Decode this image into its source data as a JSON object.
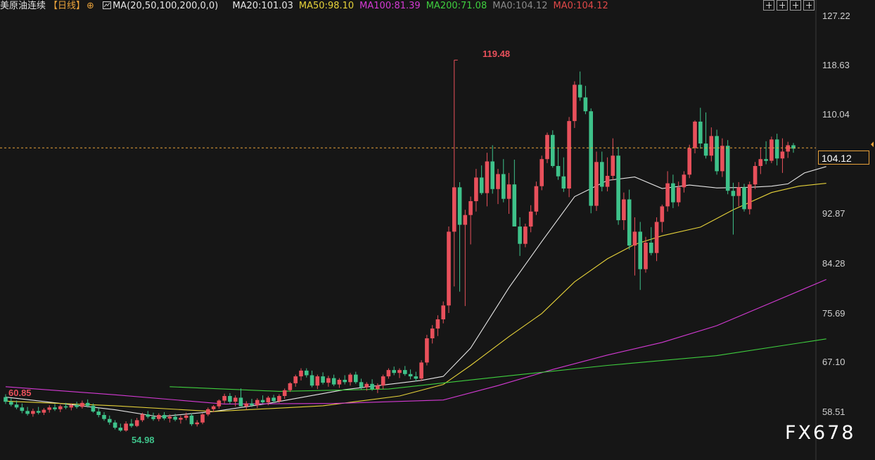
{
  "legend": {
    "title": "美原油连续",
    "period": "【日线】",
    "indicator": "MA(20,50,100,200,0,0)",
    "items": [
      {
        "label": "MA20:101.03",
        "color": "#e6e6e6"
      },
      {
        "label": "MA50:98.10",
        "color": "#e6d23a"
      },
      {
        "label": "MA100:81.39",
        "color": "#d43ad4"
      },
      {
        "label": "MA200:71.08",
        "color": "#3fcf3f"
      },
      {
        "label": "MA0:104.12",
        "color": "#8a8a8a"
      },
      {
        "label": "MA0:104.12",
        "color": "#e04848"
      }
    ]
  },
  "toolbar": {
    "icons": [
      "zoom-in-icon",
      "zoom-out-icon",
      "scroll-left-icon",
      "scroll-right-icon"
    ]
  },
  "last_price": "104.12",
  "watermark": "FX678",
  "colors": {
    "up": "#e8505b",
    "down": "#3ec28a",
    "bg": "#161616",
    "grid": "#2a2a2a",
    "last": "#e8a13a"
  },
  "chart_data": {
    "type": "candlestick",
    "title": "美原油连续",
    "y_ticks": [
      "127.22",
      "118.63",
      "110.04",
      "104.12",
      "92.87",
      "84.28",
      "75.69",
      "67.10",
      "58.51"
    ],
    "ylim": [
      54.0,
      127.22
    ],
    "annotations": [
      {
        "label": "119.48",
        "kind": "high",
        "color": "#e8505b"
      },
      {
        "label": "60.85",
        "kind": "left",
        "color": "#e8505b"
      },
      {
        "label": "54.98",
        "kind": "low",
        "color": "#3ec28a"
      }
    ],
    "candles": [
      [
        61.0,
        61.5,
        59.8,
        60.2
      ],
      [
        60.2,
        60.8,
        59.4,
        59.7
      ],
      [
        59.7,
        60.4,
        58.9,
        59.2
      ],
      [
        59.2,
        59.9,
        58.2,
        58.6
      ],
      [
        58.6,
        59.3,
        57.8,
        58.1
      ],
      [
        58.1,
        59.0,
        57.6,
        58.6
      ],
      [
        58.6,
        59.3,
        58.0,
        58.3
      ],
      [
        58.3,
        59.1,
        57.9,
        58.8
      ],
      [
        58.8,
        59.6,
        58.3,
        59.2
      ],
      [
        59.2,
        59.8,
        58.6,
        58.9
      ],
      [
        58.9,
        59.7,
        58.4,
        59.4
      ],
      [
        59.4,
        60.0,
        58.9,
        59.2
      ],
      [
        59.2,
        59.9,
        58.7,
        59.6
      ],
      [
        59.6,
        60.2,
        59.0,
        59.3
      ],
      [
        59.3,
        60.4,
        59.0,
        60.0
      ],
      [
        60.0,
        60.6,
        59.2,
        59.5
      ],
      [
        59.5,
        59.9,
        58.3,
        58.5
      ],
      [
        58.5,
        59.1,
        57.5,
        57.9
      ],
      [
        57.9,
        58.4,
        56.9,
        57.2
      ],
      [
        57.2,
        57.8,
        56.2,
        56.6
      ],
      [
        56.6,
        57.0,
        55.4,
        55.7
      ],
      [
        55.7,
        56.4,
        54.98,
        55.2
      ],
      [
        55.2,
        56.8,
        55.0,
        56.4
      ],
      [
        56.4,
        57.2,
        55.7,
        56.0
      ],
      [
        56.0,
        57.4,
        55.8,
        57.0
      ],
      [
        57.0,
        58.3,
        56.7,
        58.0
      ],
      [
        58.0,
        58.6,
        57.3,
        57.6
      ],
      [
        57.6,
        58.3,
        56.9,
        57.2
      ],
      [
        57.2,
        58.2,
        56.8,
        57.9
      ],
      [
        57.9,
        58.4,
        57.0,
        57.3
      ],
      [
        57.3,
        58.0,
        56.6,
        57.6
      ],
      [
        57.6,
        58.1,
        56.8,
        57.1
      ],
      [
        57.1,
        57.8,
        56.4,
        57.4
      ],
      [
        57.4,
        58.3,
        57.0,
        57.8
      ],
      [
        57.8,
        58.2,
        56.0,
        56.3
      ],
      [
        56.3,
        57.0,
        55.9,
        56.6
      ],
      [
        56.6,
        58.2,
        56.3,
        58.0
      ],
      [
        58.0,
        59.2,
        57.7,
        58.9
      ],
      [
        58.9,
        59.6,
        58.4,
        59.4
      ],
      [
        59.4,
        60.6,
        59.0,
        60.4
      ],
      [
        60.4,
        61.6,
        59.9,
        61.2
      ],
      [
        61.2,
        61.7,
        59.8,
        60.2
      ],
      [
        60.2,
        61.3,
        59.4,
        60.9
      ],
      [
        60.9,
        62.5,
        60.2,
        59.4
      ],
      [
        59.4,
        60.3,
        58.8,
        59.9
      ],
      [
        59.9,
        60.7,
        59.3,
        59.6
      ],
      [
        59.6,
        60.8,
        59.1,
        60.5
      ],
      [
        60.5,
        61.3,
        59.9,
        60.1
      ],
      [
        60.1,
        61.2,
        59.6,
        60.9
      ],
      [
        60.9,
        61.4,
        60.0,
        60.3
      ],
      [
        60.3,
        61.5,
        60.0,
        61.2
      ],
      [
        61.2,
        62.5,
        60.7,
        62.2
      ],
      [
        62.2,
        63.6,
        61.9,
        63.4
      ],
      [
        63.4,
        64.9,
        62.8,
        64.6
      ],
      [
        64.6,
        66.0,
        63.9,
        65.6
      ],
      [
        65.6,
        66.0,
        64.4,
        64.8
      ],
      [
        64.8,
        65.6,
        62.7,
        63.0
      ],
      [
        63.0,
        64.9,
        62.4,
        64.6
      ],
      [
        64.6,
        65.3,
        63.2,
        63.5
      ],
      [
        63.5,
        64.7,
        62.8,
        64.3
      ],
      [
        64.3,
        64.9,
        62.9,
        63.2
      ],
      [
        63.2,
        64.3,
        62.6,
        64.0
      ],
      [
        64.0,
        64.8,
        63.2,
        63.6
      ],
      [
        63.6,
        65.2,
        63.0,
        64.9
      ],
      [
        64.9,
        65.4,
        63.3,
        63.6
      ],
      [
        63.6,
        64.2,
        62.3,
        62.7
      ],
      [
        62.7,
        63.6,
        62.1,
        63.3
      ],
      [
        63.3,
        64.1,
        62.1,
        62.4
      ],
      [
        62.4,
        63.4,
        61.7,
        63.0
      ],
      [
        63.0,
        64.9,
        62.4,
        64.6
      ],
      [
        64.6,
        66.0,
        64.2,
        65.7
      ],
      [
        65.7,
        66.3,
        64.8,
        65.2
      ],
      [
        65.2,
        66.0,
        64.3,
        65.7
      ],
      [
        65.7,
        66.4,
        64.7,
        65.0
      ],
      [
        65.0,
        65.8,
        64.1,
        64.6
      ],
      [
        64.6,
        65.4,
        63.7,
        64.2
      ],
      [
        64.2,
        67.4,
        63.8,
        67.0
      ],
      [
        67.0,
        71.8,
        66.5,
        71.2
      ],
      [
        71.2,
        73.5,
        70.3,
        72.9
      ],
      [
        72.9,
        75.2,
        71.6,
        74.5
      ],
      [
        74.5,
        77.6,
        73.8,
        76.9
      ],
      [
        76.9,
        90.6,
        75.6,
        89.7
      ],
      [
        89.7,
        119.48,
        80.2,
        97.4
      ],
      [
        97.4,
        98.3,
        79.3,
        90.9
      ],
      [
        90.9,
        93.5,
        76.8,
        92.6
      ],
      [
        92.6,
        95.8,
        87.5,
        95.0
      ],
      [
        95.0,
        100.6,
        93.2,
        99.1
      ],
      [
        99.1,
        101.2,
        96.1,
        96.4
      ],
      [
        96.4,
        103.4,
        94.1,
        101.9
      ],
      [
        101.9,
        104.7,
        96.3,
        97.1
      ],
      [
        97.1,
        100.6,
        94.5,
        99.7
      ],
      [
        99.7,
        102.3,
        94.8,
        95.4
      ],
      [
        95.4,
        99.9,
        92.8,
        97.9
      ],
      [
        97.9,
        102.2,
        92.3,
        90.6
      ],
      [
        90.6,
        92.2,
        85.5,
        87.6
      ],
      [
        87.6,
        91.1,
        87.0,
        90.6
      ],
      [
        90.6,
        94.3,
        89.6,
        93.2
      ],
      [
        93.2,
        98.4,
        92.6,
        97.6
      ],
      [
        97.6,
        102.9,
        96.9,
        102.3
      ],
      [
        102.3,
        106.9,
        101.6,
        106.5
      ],
      [
        106.5,
        107.3,
        100.8,
        101.1
      ],
      [
        101.1,
        104.2,
        98.7,
        99.3
      ],
      [
        99.3,
        102.6,
        96.6,
        97.2
      ],
      [
        97.2,
        109.6,
        95.7,
        108.9
      ],
      [
        108.9,
        115.8,
        107.7,
        115.2
      ],
      [
        115.2,
        117.5,
        112.4,
        113.0
      ],
      [
        113.0,
        115.0,
        110.1,
        110.6
      ],
      [
        110.6,
        111.1,
        92.9,
        94.2
      ],
      [
        94.2,
        103.6,
        93.3,
        101.8
      ],
      [
        101.8,
        103.6,
        96.7,
        97.5
      ],
      [
        97.5,
        102.6,
        96.7,
        99.4
      ],
      [
        99.4,
        105.9,
        98.6,
        102.9
      ],
      [
        102.9,
        104.4,
        90.9,
        91.7
      ],
      [
        91.7,
        96.5,
        90.0,
        95.3
      ],
      [
        95.3,
        97.0,
        86.6,
        87.3
      ],
      [
        87.3,
        92.2,
        82.1,
        89.7
      ],
      [
        89.7,
        91.4,
        79.6,
        83.2
      ],
      [
        83.2,
        88.8,
        82.6,
        87.8
      ],
      [
        87.8,
        90.5,
        85.6,
        86.0
      ],
      [
        86.0,
        92.2,
        84.6,
        91.4
      ],
      [
        91.4,
        94.4,
        89.6,
        94.1
      ],
      [
        94.1,
        100.2,
        93.2,
        98.1
      ],
      [
        98.1,
        99.6,
        93.8,
        94.8
      ],
      [
        94.8,
        98.4,
        94.1,
        97.4
      ],
      [
        97.4,
        100.2,
        96.5,
        99.6
      ],
      [
        99.6,
        104.8,
        99.0,
        104.2
      ],
      [
        104.2,
        109.0,
        103.3,
        108.8
      ],
      [
        108.8,
        111.2,
        104.1,
        105.0
      ],
      [
        105.0,
        110.4,
        102.4,
        102.9
      ],
      [
        102.9,
        107.8,
        101.9,
        106.3
      ],
      [
        106.3,
        107.4,
        99.6,
        100.2
      ],
      [
        100.2,
        105.9,
        99.2,
        104.6
      ],
      [
        104.6,
        105.6,
        96.2,
        96.8
      ],
      [
        96.8,
        98.2,
        89.2,
        95.9
      ],
      [
        95.9,
        98.3,
        94.1,
        97.4
      ],
      [
        97.4,
        98.0,
        93.2,
        93.6
      ],
      [
        93.6,
        98.4,
        92.7,
        97.9
      ],
      [
        97.9,
        101.8,
        97.1,
        101.1
      ],
      [
        101.1,
        104.2,
        99.7,
        102.3
      ],
      [
        102.3,
        105.4,
        101.4,
        102.0
      ],
      [
        102.0,
        106.2,
        101.6,
        105.7
      ],
      [
        105.7,
        106.7,
        101.2,
        102.4
      ],
      [
        102.4,
        105.9,
        99.9,
        103.6
      ],
      [
        103.6,
        105.3,
        102.5,
        104.7
      ],
      [
        104.7,
        105.1,
        103.4,
        104.12
      ]
    ],
    "series": [
      {
        "name": "MA20",
        "color": "#e6e6e6",
        "points": [
          [
            0,
            61.0
          ],
          [
            20,
            58.8
          ],
          [
            28,
            57.6
          ],
          [
            38,
            58.5
          ],
          [
            48,
            59.9
          ],
          [
            62,
            62.3
          ],
          [
            76,
            63.9
          ],
          [
            80,
            64.6
          ],
          [
            85,
            69.5
          ],
          [
            92,
            80.0
          ],
          [
            98,
            88.0
          ],
          [
            104,
            95.8
          ],
          [
            110,
            98.6
          ],
          [
            115,
            99.2
          ],
          [
            120,
            97.2
          ],
          [
            125,
            97.8
          ],
          [
            130,
            97.3
          ],
          [
            136,
            97.4
          ],
          [
            140,
            97.6
          ],
          [
            143,
            98.0
          ],
          [
            146,
            99.9
          ],
          [
            150,
            101.0
          ]
        ]
      },
      {
        "name": "MA50",
        "color": "#e6d23a",
        "points": [
          [
            0,
            60.3
          ],
          [
            20,
            59.5
          ],
          [
            38,
            58.5
          ],
          [
            58,
            59.5
          ],
          [
            72,
            61.2
          ],
          [
            80,
            63.2
          ],
          [
            85,
            66.5
          ],
          [
            92,
            71.5
          ],
          [
            98,
            75.5
          ],
          [
            104,
            81.0
          ],
          [
            110,
            85.0
          ],
          [
            115,
            87.5
          ],
          [
            120,
            89.0
          ],
          [
            127,
            90.5
          ],
          [
            133,
            93.5
          ],
          [
            140,
            96.5
          ],
          [
            145,
            97.6
          ],
          [
            150,
            98.1
          ]
        ]
      },
      {
        "name": "MA100",
        "color": "#d43ad4",
        "points": [
          [
            0,
            62.8
          ],
          [
            20,
            61.4
          ],
          [
            40,
            59.8
          ],
          [
            60,
            59.9
          ],
          [
            80,
            60.5
          ],
          [
            90,
            63.0
          ],
          [
            100,
            65.8
          ],
          [
            110,
            68.3
          ],
          [
            120,
            70.5
          ],
          [
            130,
            73.4
          ],
          [
            140,
            77.4
          ],
          [
            150,
            81.4
          ]
        ]
      },
      {
        "name": "MA200",
        "color": "#3fcf3f",
        "points": [
          [
            30,
            62.8
          ],
          [
            50,
            62.0
          ],
          [
            70,
            62.4
          ],
          [
            90,
            64.5
          ],
          [
            110,
            66.5
          ],
          [
            130,
            68.2
          ],
          [
            150,
            71.1
          ]
        ]
      }
    ]
  }
}
